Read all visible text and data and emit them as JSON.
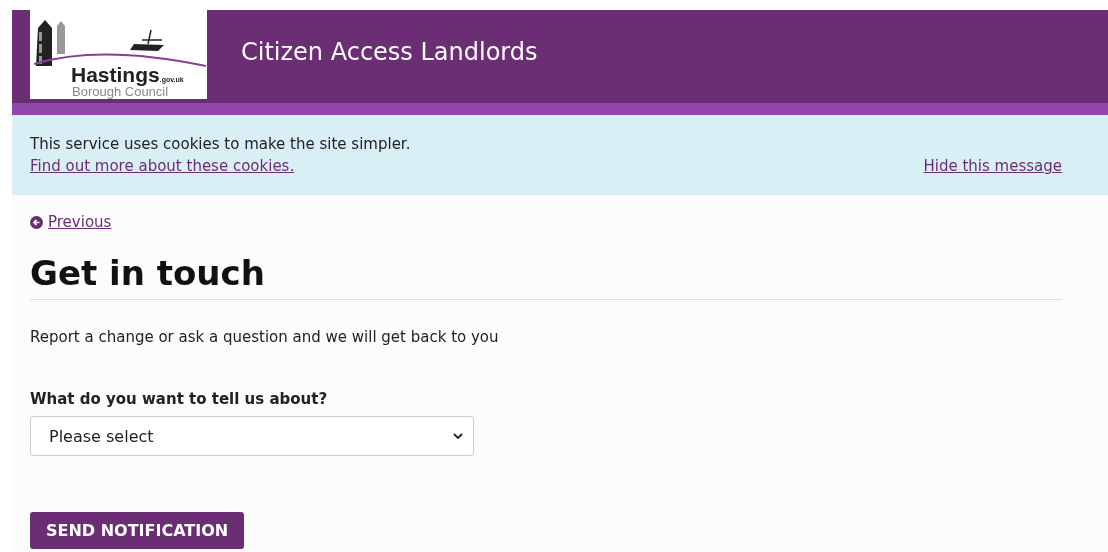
{
  "header": {
    "logo": {
      "name": "Hastings",
      "suffix": ".gov.uk",
      "subtitle": "Borough Council"
    },
    "title": "Citizen Access Landlords"
  },
  "cookie_banner": {
    "message": "This service uses cookies to make the site simpler.",
    "more_link": "Find out more about these cookies.",
    "hide_link": "Hide this message"
  },
  "back_link": "Previous",
  "heading": "Get in touch",
  "intro": "Report a change or ask a question and we will get back to you",
  "form": {
    "label": "What do you want to tell us about?",
    "select": {
      "value": "Please select"
    },
    "submit": "SEND NOTIFICATION"
  }
}
